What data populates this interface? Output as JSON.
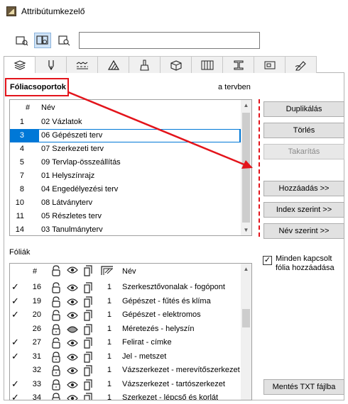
{
  "window": {
    "title": "Attribútumkezelő"
  },
  "toolbar": {
    "view_buttons": [
      {
        "icon": "file-view-icon",
        "active": false
      },
      {
        "icon": "compare-view-icon",
        "active": true
      },
      {
        "icon": "project-view-icon",
        "active": false
      }
    ],
    "search_value": ""
  },
  "tabs": [
    {
      "icon": "layers-icon",
      "active": true
    },
    {
      "icon": "pen-icon",
      "active": false
    },
    {
      "icon": "line-type-icon",
      "active": false
    },
    {
      "icon": "fill-icon",
      "active": false
    },
    {
      "icon": "surface-icon",
      "active": false
    },
    {
      "icon": "building-material-icon",
      "active": false
    },
    {
      "icon": "composite-icon",
      "active": false
    },
    {
      "icon": "profile-icon",
      "active": false
    },
    {
      "icon": "zone-icon",
      "active": false
    },
    {
      "icon": "markup-icon",
      "active": false
    }
  ],
  "groups": {
    "title": "Fóliacsoportok",
    "in_project_label": "a tervben",
    "header_num": "#",
    "header_name": "Név",
    "rows": [
      {
        "num": "1",
        "name": "02 Vázlatok",
        "selected": false
      },
      {
        "num": "3",
        "name": "06 Gépészeti terv",
        "selected": true
      },
      {
        "num": "4",
        "name": "07 Szerkezeti terv",
        "selected": false
      },
      {
        "num": "5",
        "name": "09 Tervlap-összeállítás",
        "selected": false
      },
      {
        "num": "7",
        "name": "01 Helyszínrajz",
        "selected": false
      },
      {
        "num": "8",
        "name": "04 Engedélyezési terv",
        "selected": false
      },
      {
        "num": "10",
        "name": "08 Látványterv",
        "selected": false
      },
      {
        "num": "11",
        "name": "05 Részletes terv",
        "selected": false
      },
      {
        "num": "14",
        "name": "03 Tanulmányterv",
        "selected": false
      }
    ]
  },
  "buttons": {
    "duplicate": "Duplikálás",
    "delete": "Törlés",
    "purge": "Takarítás",
    "add": "Hozzáadás >>",
    "by_index": "Index szerint >>",
    "by_name": "Név szerint >>",
    "save_txt": "Mentés TXT fájlba"
  },
  "add_all_checkbox": {
    "checked": true,
    "label": "Minden kapcsolt fólia hozzáadása"
  },
  "layers": {
    "title": "Fóliák",
    "header_num": "#",
    "header_name": "Név",
    "rows": [
      {
        "checked": true,
        "num": "16",
        "locked": false,
        "visible": true,
        "solid": true,
        "pen": "1",
        "name": "Szerkesztővonalak - fogópont"
      },
      {
        "checked": true,
        "num": "19",
        "locked": false,
        "visible": true,
        "solid": true,
        "pen": "1",
        "name": "Gépészet - fűtés és klíma"
      },
      {
        "checked": true,
        "num": "20",
        "locked": false,
        "visible": true,
        "solid": true,
        "pen": "1",
        "name": "Gépészet - elektromos"
      },
      {
        "checked": false,
        "num": "26",
        "locked": true,
        "visible": false,
        "solid": true,
        "pen": "1",
        "name": "Méretezés - helyszín"
      },
      {
        "checked": true,
        "num": "27",
        "locked": false,
        "visible": true,
        "solid": true,
        "pen": "1",
        "name": "Felirat - címke"
      },
      {
        "checked": true,
        "num": "31",
        "locked": true,
        "visible": true,
        "solid": true,
        "pen": "1",
        "name": "Jel - metszet"
      },
      {
        "checked": false,
        "num": "32",
        "locked": true,
        "visible": true,
        "solid": true,
        "pen": "1",
        "name": "Vázszerkezet - merevítőszerkezet"
      },
      {
        "checked": true,
        "num": "33",
        "locked": true,
        "visible": true,
        "solid": true,
        "pen": "1",
        "name": "Vázszerkezet - tartószerkezet"
      },
      {
        "checked": true,
        "num": "34",
        "locked": true,
        "visible": true,
        "solid": true,
        "pen": "1",
        "name": "Szerkezet - lépcső és korlát"
      }
    ]
  },
  "colors": {
    "annotation_red": "#e3141b",
    "selection_blue": "#0078d7"
  }
}
